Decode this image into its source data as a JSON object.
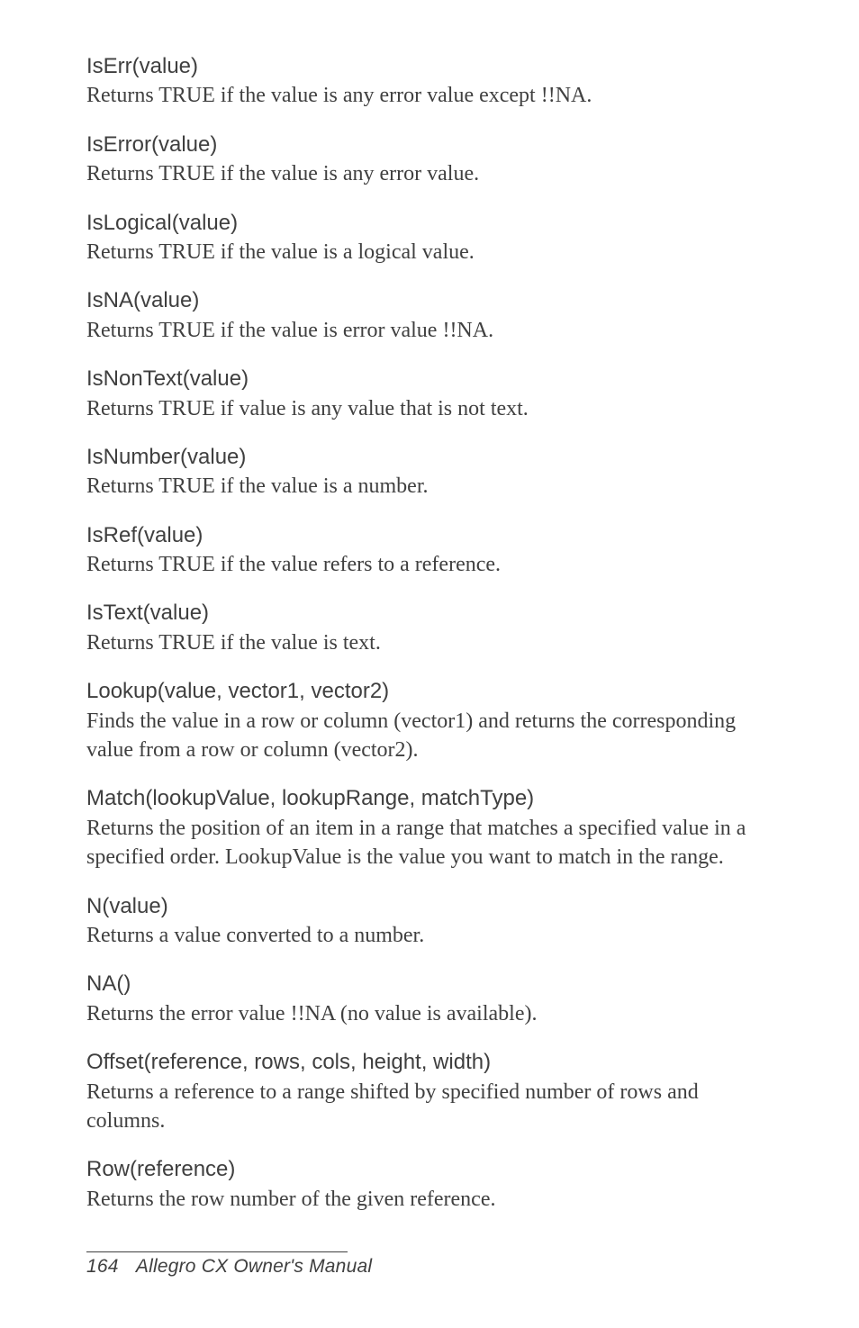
{
  "entries": [
    {
      "sig": "IsErr(value)",
      "desc": "Returns TRUE if the value is any error value except !!NA."
    },
    {
      "sig": "IsError(value)",
      "desc": "Returns TRUE if the value is any error value."
    },
    {
      "sig": "IsLogical(value)",
      "desc": "Returns TRUE if the value is a logical value."
    },
    {
      "sig": "IsNA(value)",
      "desc": "Returns TRUE if the value is error value !!NA."
    },
    {
      "sig": "IsNonText(value)",
      "desc": "Returns TRUE if value is any value that is not text."
    },
    {
      "sig": "IsNumber(value)",
      "desc": "Returns TRUE if the value is a number."
    },
    {
      "sig": "IsRef(value)",
      "desc": "Returns TRUE if the value refers to a reference."
    },
    {
      "sig": "IsText(value)",
      "desc": "Returns TRUE if the value is text."
    },
    {
      "sig": "Lookup(value, vector1, vector2)",
      "desc": "Finds the value in a row or column (vector1) and returns the corresponding value from a row or column (vector2)."
    },
    {
      "sig": "Match(lookupValue, lookupRange, matchType)",
      "desc": "Returns the position of an item in a range that matches a specified value in a specified order. LookupValue is the value you want to match in the range."
    },
    {
      "sig": "N(value)",
      "desc": "Returns a value converted to a number."
    },
    {
      "sig": "NA()",
      "desc": "Returns the error value !!NA (no value is available)."
    },
    {
      "sig": "Offset(reference, rows, cols, height, width)",
      "desc": "Returns a reference to a range shifted by specified number of rows and columns."
    },
    {
      "sig": "Row(reference)",
      "desc": "Returns the row number of the given reference."
    }
  ],
  "footer": {
    "page": "164",
    "title": "Allegro CX Owner's Manual"
  }
}
